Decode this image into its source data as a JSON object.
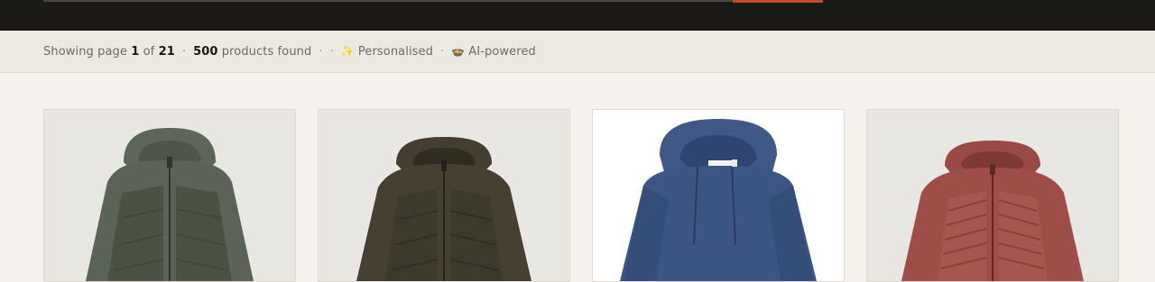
{
  "header": {
    "search_accent": "#c24a2e"
  },
  "results": {
    "showing_prefix": "Showing page",
    "page_current": "1",
    "of_label": "of",
    "page_total": "21",
    "sep": "·",
    "count": "500",
    "count_label": "products found",
    "personalised_icon": "✨",
    "personalised_label": "Personalised",
    "ai_icon": "🍲",
    "ai_label": "AI-powered"
  },
  "products": [
    {
      "name": "jacket-green",
      "body_color": "#5b6257",
      "panel_color": "#4b5143",
      "bg": "#e9e7e4",
      "icon": "hooded-jacket-image"
    },
    {
      "name": "jacket-brown",
      "body_color": "#45402f",
      "panel_color": "#3b3a2b",
      "bg": "#e9e7e4",
      "icon": "hooded-jacket-image"
    },
    {
      "name": "hoodie-blue",
      "body_color": "#3c5583",
      "panel_color": "#3c5583",
      "bg": "#ffffff",
      "icon": "knit-hoodie-image"
    },
    {
      "name": "jacket-rose",
      "body_color": "#9e4d49",
      "panel_color": "#a85651",
      "bg": "#e9e7e4",
      "icon": "puffer-jacket-image"
    }
  ]
}
